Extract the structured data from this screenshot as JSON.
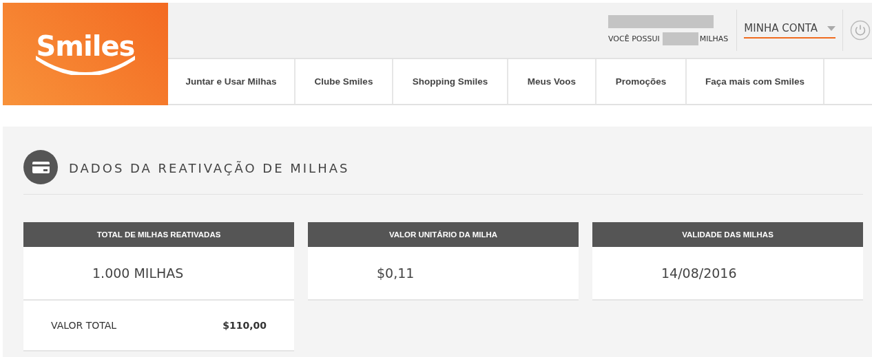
{
  "logo": {
    "text": "Smiles"
  },
  "account": {
    "miles_prefix": "VOCÊ POSSUI",
    "miles_suffix": "MILHAS",
    "menu_label": "MINHA CONTA"
  },
  "nav": [
    {
      "label": "Juntar e Usar Milhas"
    },
    {
      "label": "Clube Smiles"
    },
    {
      "label": "Shopping Smiles"
    },
    {
      "label": "Meus Voos"
    },
    {
      "label": "Promoções"
    },
    {
      "label": "Faça mais com Smiles"
    }
  ],
  "section": {
    "title": "DADOS DA REATIVAÇÃO DE MILHAS"
  },
  "cards": [
    {
      "header": "TOTAL DE MILHAS REATIVADAS",
      "value": "1.000 MILHAS",
      "total_label": "VALOR TOTAL",
      "total_value": "$110,00"
    },
    {
      "header": "VALOR UNITÁRIO DA MILHA",
      "value": "$0,11"
    },
    {
      "header": "VALIDADE DAS MILHAS",
      "value": "14/08/2016"
    }
  ]
}
